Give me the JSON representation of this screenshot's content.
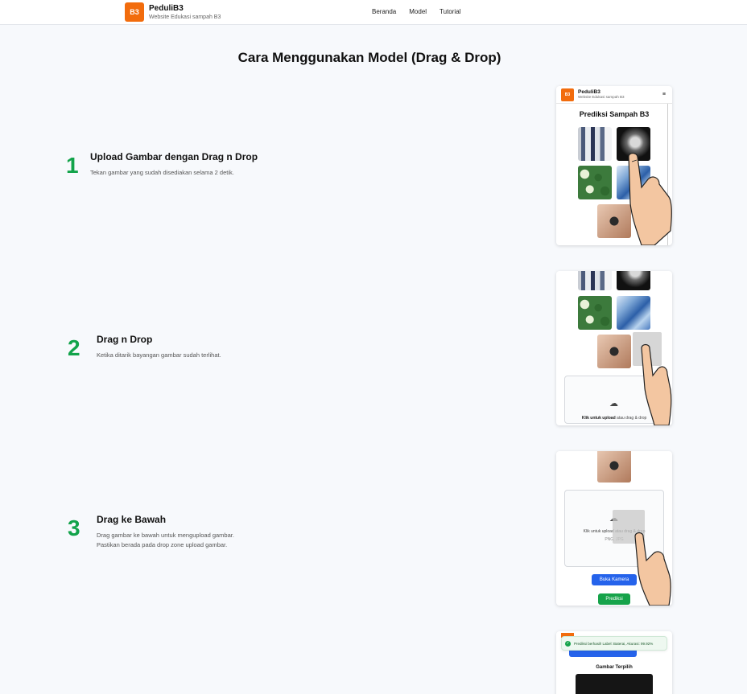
{
  "nav": {
    "logo_text": "B3",
    "brand_name": "PeduliB3",
    "brand_sub": "Website Edukasi sampah B3",
    "links": [
      "Beranda",
      "Model",
      "Tutorial"
    ]
  },
  "title": "Cara Menggunakan Model (Drag & Drop)",
  "steps": [
    {
      "num": "1",
      "title": "Upload Gambar dengan Drag n Drop",
      "desc": "Tekan gambar yang sudah disediakan selama 2 detik."
    },
    {
      "num": "2",
      "title": "Drag n Drop",
      "desc": "Ketika ditarik bayangan gambar sudah terlihat."
    },
    {
      "num": "3",
      "title": "Drag ke Bawah",
      "desc": "Drag gambar ke bawah untuk mengupload gambar.\nPastikan berada pada drop zone upload gambar."
    }
  ],
  "card1": {
    "logo_text": "B3",
    "brand_name": "PeduliB3",
    "brand_sub": "Website Edukasi sampah B3",
    "menu_icon": "≡",
    "heading": "Prediksi Sampah B3"
  },
  "card2": {
    "dz_bold": "Klik untuk upload",
    "dz_rest": " atau drag & drop"
  },
  "card3": {
    "dz_text": "Klik untuk upload atau drag & drop",
    "dz_sub": "PNG, JPG",
    "buka_kamera": "Buka Kamera",
    "prediksi": "Prediksi"
  },
  "card4": {
    "toast": "Prediksi berhasil! Label: Baterai, Akurasi: 99.92%",
    "selected_heading": "Gambar Terpilih"
  },
  "colors": {
    "brand": "#f26c0d",
    "step_number": "#12a34a",
    "primary": "#2563eb",
    "success": "#16a34a"
  }
}
